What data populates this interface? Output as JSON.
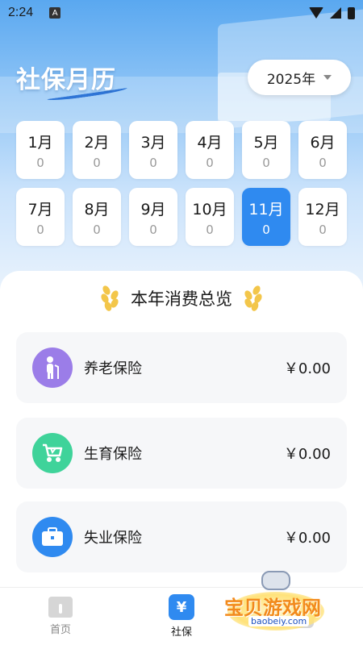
{
  "statusbar": {
    "time": "2:24",
    "badge": "A"
  },
  "header": {
    "title": "社保月历",
    "year": "2025年"
  },
  "months": [
    {
      "label": "1月",
      "value": "0",
      "active": false
    },
    {
      "label": "2月",
      "value": "0",
      "active": false
    },
    {
      "label": "3月",
      "value": "0",
      "active": false
    },
    {
      "label": "4月",
      "value": "0",
      "active": false
    },
    {
      "label": "5月",
      "value": "0",
      "active": false
    },
    {
      "label": "6月",
      "value": "0",
      "active": false
    },
    {
      "label": "7月",
      "value": "0",
      "active": false
    },
    {
      "label": "8月",
      "value": "0",
      "active": false
    },
    {
      "label": "9月",
      "value": "0",
      "active": false
    },
    {
      "label": "10月",
      "value": "0",
      "active": false
    },
    {
      "label": "11月",
      "value": "0",
      "active": true
    },
    {
      "label": "12月",
      "value": "0",
      "active": false
    }
  ],
  "overview": {
    "title": "本年消费总览"
  },
  "insurance": [
    {
      "name": "养老保险",
      "amount": "￥0.00",
      "icon": "elderly-person-icon",
      "color": "#9b7de8"
    },
    {
      "name": "生育保险",
      "amount": "￥0.00",
      "icon": "baby-stroller-icon",
      "color": "#3fd39a"
    },
    {
      "name": "失业保险",
      "amount": "￥0.00",
      "icon": "briefcase-icon",
      "color": "#2f8af0"
    }
  ],
  "tabbar": {
    "home": "首页",
    "shebao": "社保",
    "shebao_glyph": "¥"
  },
  "watermark": {
    "text": "宝贝游戏网",
    "url": "baobeiy.com"
  },
  "colors": {
    "accent": "#2f8af0",
    "hero_top": "#5aa8f0"
  }
}
